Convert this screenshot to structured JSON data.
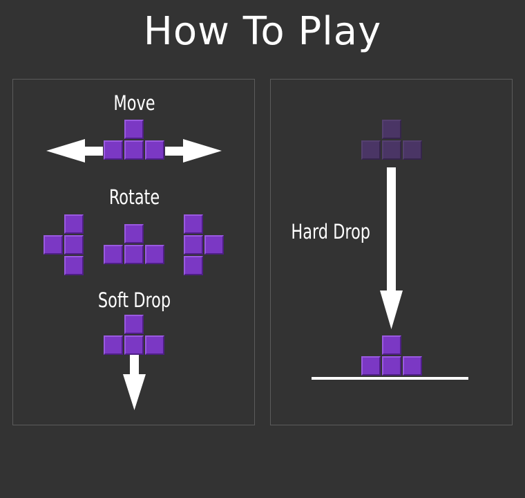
{
  "title": "How To Play",
  "controls": {
    "move_label": "Move",
    "rotate_label": "Rotate",
    "soft_drop_label": "Soft Drop",
    "hard_drop_label": "Hard Drop"
  },
  "colors": {
    "background": "#333333",
    "panel_border": "#5c5c5c",
    "piece": "#7b38c4",
    "ghost_piece": "#4a3565",
    "arrow": "#ffffff"
  },
  "icons": [
    "arrow-left-icon",
    "arrow-right-icon",
    "arrow-down-icon",
    "t-piece-icon",
    "ghost-piece-icon",
    "floor-line"
  ]
}
